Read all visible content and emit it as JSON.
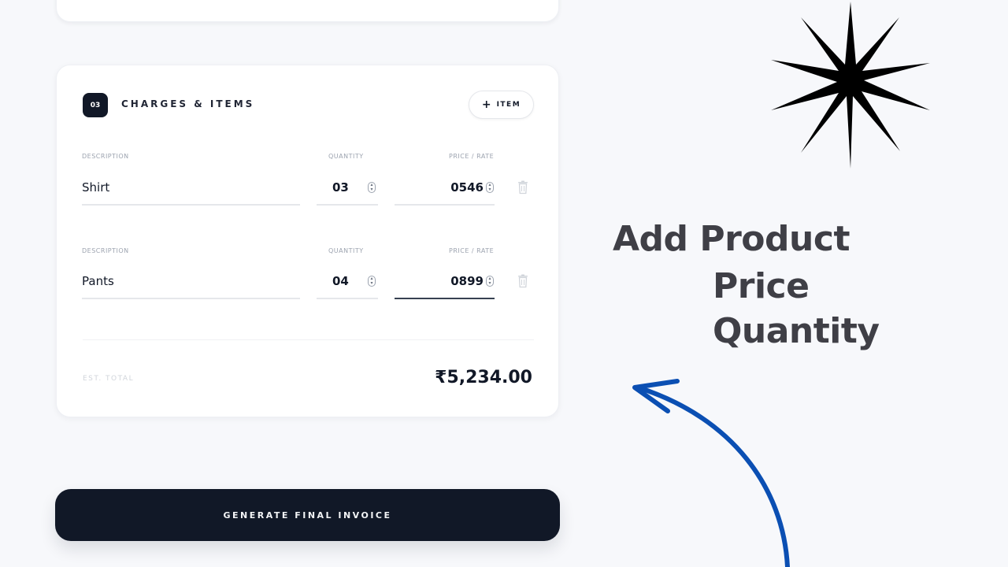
{
  "section": {
    "step_number": "03",
    "title": "CHARGES & ITEMS",
    "add_item_label": "ITEM"
  },
  "columns": {
    "description": "DESCRIPTION",
    "quantity": "QUANTITY",
    "price": "PRICE / RATE"
  },
  "items": [
    {
      "description": "Shirt",
      "quantity": "03",
      "price": "0546"
    },
    {
      "description": "Pants",
      "quantity": "04",
      "price": "0899"
    }
  ],
  "summary": {
    "est_total_label": "EST. TOTAL",
    "est_total_value": "₹5,234.00"
  },
  "generate_button_label": "GENERATE FINAL INVOICE",
  "annotation": {
    "line1": "Add Product",
    "line2": "Price",
    "line3": "Quantity"
  },
  "colors": {
    "primary_dark": "#111827",
    "arrow": "#0b4fb3",
    "annotation_text": "#3f3f46",
    "background": "#f7f8fb"
  },
  "icons": [
    "plus-icon",
    "spinner-icon",
    "trash-icon",
    "starburst-icon",
    "curved-arrow-icon"
  ]
}
